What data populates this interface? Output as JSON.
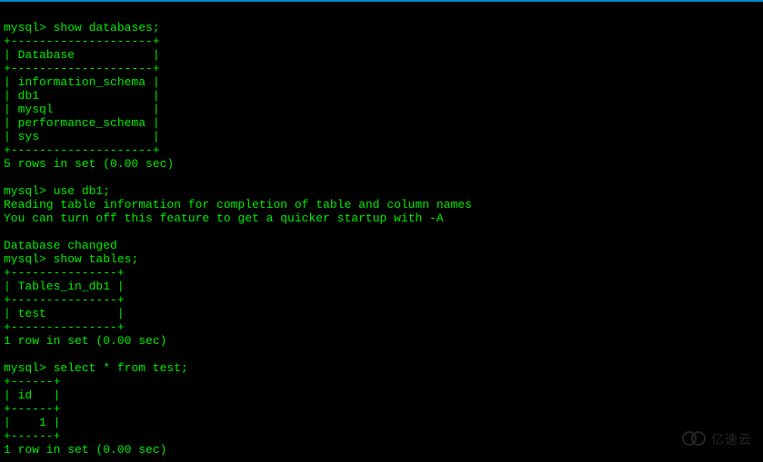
{
  "terminal": {
    "prompt": "mysql>",
    "commands": {
      "show_databases": "show databases;",
      "use_db1": "use db1;",
      "show_tables": "show tables;",
      "select_test": "select * from test;"
    },
    "tables": {
      "databases": {
        "border": "+--------------------+",
        "header": "| Database           |",
        "rows": [
          "| information_schema |",
          "| db1                |",
          "| mysql              |",
          "| performance_schema |",
          "| sys                |"
        ],
        "footer": "5 rows in set (0.00 sec)"
      },
      "tables_in_db1": {
        "border": "+---------------+",
        "header": "| Tables_in_db1 |",
        "rows": [
          "| test          |"
        ],
        "footer": "1 row in set (0.00 sec)"
      },
      "test_data": {
        "border": "+------+",
        "header": "| id   |",
        "rows": [
          "|    1 |"
        ],
        "footer": "1 row in set (0.00 sec)"
      }
    },
    "messages": {
      "reading_table": "Reading table information for completion of table and column names",
      "turn_off_feature": "You can turn off this feature to get a quicker startup with -A",
      "db_changed": "Database changed"
    }
  },
  "watermark": {
    "text": "亿速云"
  }
}
